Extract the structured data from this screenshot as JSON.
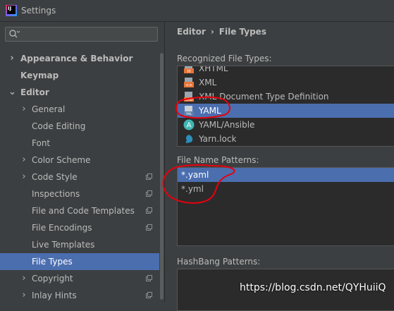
{
  "window": {
    "title": "Settings"
  },
  "search": {
    "placeholder": "",
    "value": ""
  },
  "sidebar": {
    "items": [
      {
        "label": "Appearance & Behavior"
      },
      {
        "label": "Keymap"
      },
      {
        "label": "Editor"
      },
      {
        "label": "General"
      },
      {
        "label": "Code Editing"
      },
      {
        "label": "Font"
      },
      {
        "label": "Color Scheme"
      },
      {
        "label": "Code Style"
      },
      {
        "label": "Inspections"
      },
      {
        "label": "File and Code Templates"
      },
      {
        "label": "File Encodings"
      },
      {
        "label": "Live Templates"
      },
      {
        "label": "File Types"
      },
      {
        "label": "Copyright"
      },
      {
        "label": "Inlay Hints"
      }
    ]
  },
  "breadcrumb": {
    "parent": "Editor",
    "separator": "›",
    "current": "File Types"
  },
  "recognized": {
    "label": "Recognized File Types:",
    "items": [
      {
        "label": "XHTML",
        "icon": "xhtml-file-icon"
      },
      {
        "label": "XML",
        "icon": "xml-file-icon"
      },
      {
        "label": "XML Document Type Definition",
        "icon": "dtd-file-icon"
      },
      {
        "label": "YAML",
        "icon": "yaml-file-icon"
      },
      {
        "label": "YAML/Ansible",
        "icon": "ansible-icon"
      },
      {
        "label": "Yarn.lock",
        "icon": "yarn-icon"
      }
    ]
  },
  "patterns": {
    "label": "File Name Patterns:",
    "items": [
      {
        "label": "*.yaml"
      },
      {
        "label": "*.yml"
      }
    ]
  },
  "hashbang": {
    "label": "HashBang Patterns:"
  },
  "watermark": {
    "text": "https://blog.csdn.net/QYHuiiQ"
  },
  "colors": {
    "selection": "#4b6eaf",
    "panel": "#3c3f41",
    "list_bg": "#2b2b2b",
    "annotation": "#e8000d"
  }
}
